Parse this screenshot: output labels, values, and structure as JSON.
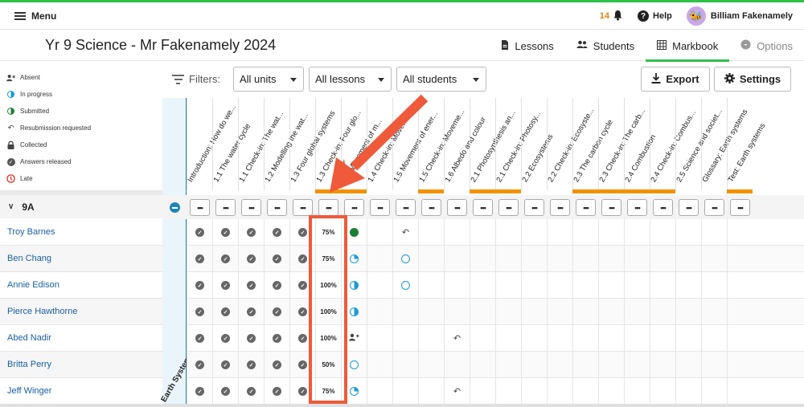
{
  "top": {
    "menu_label": "Menu",
    "notif_count": "14",
    "help_label": "Help",
    "user_name": "Billiam Fakenamely"
  },
  "title": "Yr 9 Science - Mr Fakenamely 2024",
  "tabs": [
    {
      "label": "Lessons",
      "icon": "document-icon"
    },
    {
      "label": "Students",
      "icon": "people-icon"
    },
    {
      "label": "Markbook",
      "icon": "grid-icon"
    },
    {
      "label": "Options",
      "icon": "gear-icon"
    }
  ],
  "legend": [
    {
      "label": "Absent",
      "icon": "absent-icon"
    },
    {
      "label": "In progress",
      "icon": "in-progress-icon"
    },
    {
      "label": "Submitted",
      "icon": "submitted-icon"
    },
    {
      "label": "Resubmission requested",
      "icon": "resubmission-icon"
    },
    {
      "label": "Collected",
      "icon": "lock-icon"
    },
    {
      "label": "Answers released",
      "icon": "answers-released-icon"
    },
    {
      "label": "Late",
      "icon": "late-icon"
    }
  ],
  "filters": {
    "label": "Filters:",
    "units": "All units",
    "lessons": "All lessons",
    "students": "All students"
  },
  "actions": {
    "export": "Export",
    "settings": "Settings"
  },
  "unit_name": "Earth Systems",
  "columns": [
    "Introduction: How do we...",
    "1.1 The water cycle",
    "1.1 Check-in: The wat...",
    "1.2 Modelling the wat...",
    "1.3 Four global systems",
    "1.3 Check-in: Four glo...",
    "1.4 Movement of m...",
    "1.4 Check-in: Moveme...",
    "1.5 Movement of ener...",
    "1.5 Check-in: Moveme...",
    "1.6 Albedo and colour",
    "2.1 Photosynthesis an...",
    "2.1 Check-in: Photosy...",
    "2.2 Ecosystems",
    "2.2 Check-in: Ecosyste...",
    "2.3 The carbon cycle",
    "2.3 Check-in: The carb...",
    "2.4 Combustion",
    "2.4 Check-in: Combus...",
    "2.5 Science and societ...",
    "Glossary: Earth systems",
    "Test: Earth systems"
  ],
  "dots_label": "•••",
  "class_name": "9A",
  "students": [
    {
      "name": "Troy Barnes",
      "cells": [
        "check",
        "check",
        "check",
        "check",
        "check",
        "75%",
        "submitted",
        "",
        "resub",
        "",
        "",
        "",
        "",
        "",
        "",
        "",
        "",
        "",
        "",
        "",
        "",
        ""
      ]
    },
    {
      "name": "Ben Chang",
      "cells": [
        "check",
        "check",
        "check",
        "check",
        "check",
        "75%",
        "pie",
        "",
        "ring",
        "",
        "",
        "",
        "",
        "",
        "",
        "",
        "",
        "",
        "",
        "",
        "",
        ""
      ]
    },
    {
      "name": "Annie Edison",
      "cells": [
        "check",
        "check",
        "check",
        "check",
        "check",
        "100%",
        "half",
        "",
        "ring",
        "",
        "",
        "",
        "",
        "",
        "",
        "",
        "",
        "",
        "",
        "",
        "",
        ""
      ]
    },
    {
      "name": "Pierce Hawthorne",
      "cells": [
        "check",
        "check",
        "check",
        "check",
        "check",
        "100%",
        "half",
        "",
        "",
        "",
        "",
        "",
        "",
        "",
        "",
        "",
        "",
        "",
        "",
        "",
        "",
        ""
      ]
    },
    {
      "name": "Abed Nadir",
      "cells": [
        "check",
        "check",
        "check",
        "check",
        "check",
        "100%",
        "absent",
        "",
        "",
        "",
        "resub",
        "",
        "",
        "",
        "",
        "",
        "",
        "",
        "",
        "",
        "",
        ""
      ]
    },
    {
      "name": "Britta Perry",
      "cells": [
        "check",
        "check",
        "check",
        "check",
        "check",
        "50%",
        "ring",
        "",
        "",
        "",
        "",
        "",
        "",
        "",
        "",
        "",
        "",
        "",
        "",
        "",
        "",
        ""
      ]
    },
    {
      "name": "Jeff Winger",
      "cells": [
        "check",
        "check",
        "check",
        "check",
        "check",
        "75%",
        "pie",
        "",
        "",
        "",
        "resub",
        "",
        "",
        "",
        "",
        "",
        "",
        "",
        "",
        "",
        "",
        ""
      ]
    }
  ],
  "colors": {
    "accent_green": "#2ec24a",
    "orange_marker": "#f29100",
    "highlight": "#ee5a3a",
    "link_blue": "#1a5fa3"
  }
}
